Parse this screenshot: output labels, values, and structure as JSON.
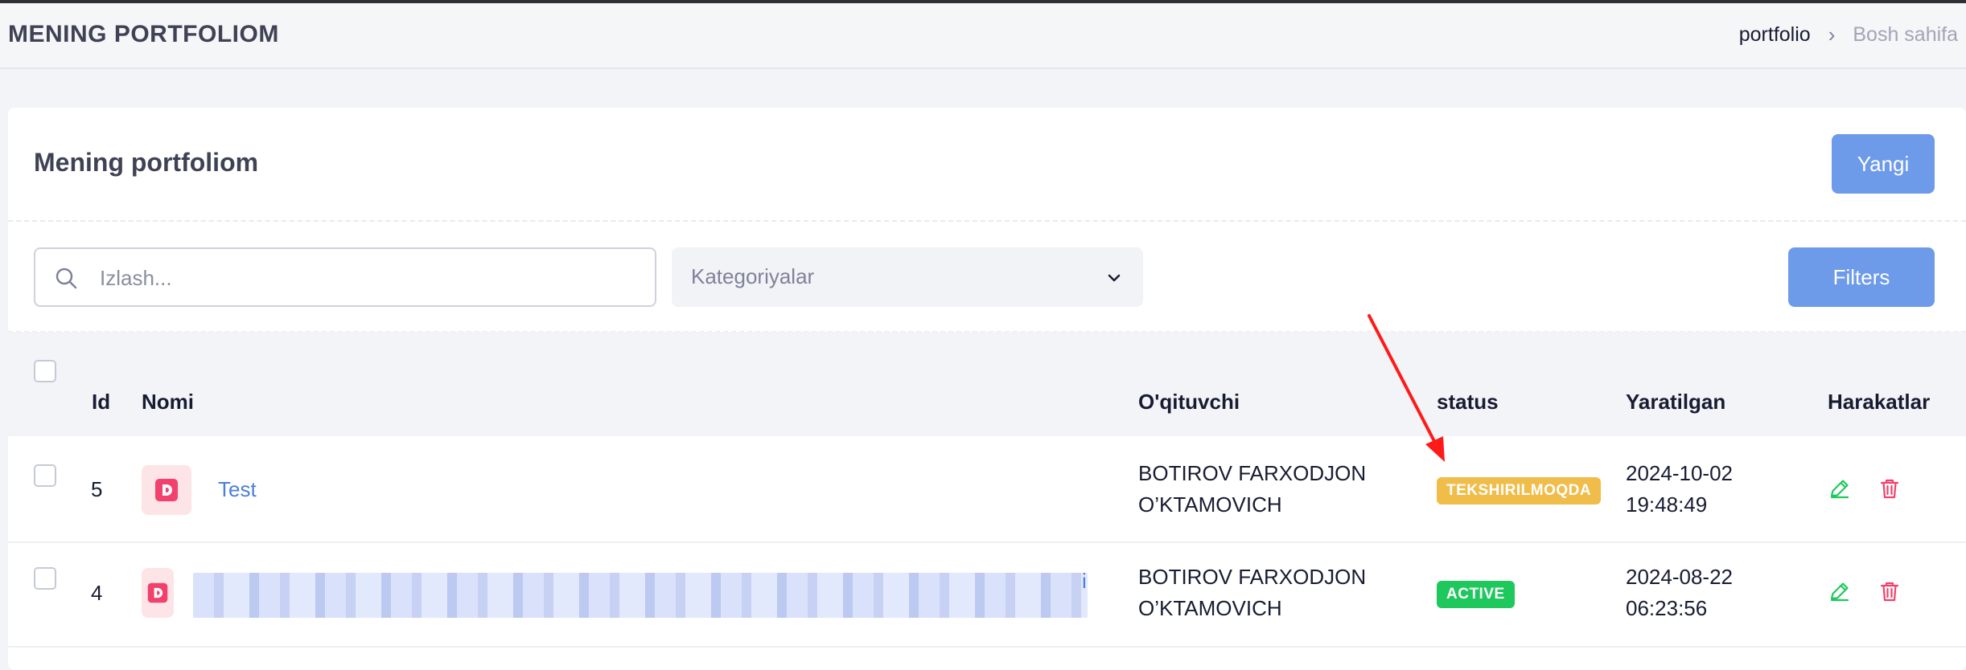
{
  "header": {
    "title": "MENING PORTFOLIOM",
    "breadcrumb": {
      "current": "portfolio",
      "separator": "›",
      "home": "Bosh sahifa"
    }
  },
  "card": {
    "title": "Mening portfoliom",
    "new_button": "Yangi",
    "filters_button": "Filters",
    "search_placeholder": "Izlash...",
    "category_select": "Kategoriyalar"
  },
  "table": {
    "columns": {
      "id": "Id",
      "name": "Nomi",
      "teacher": "O'qituvchi",
      "status": "status",
      "created": "Yaratilgan",
      "actions": "Harakatlar"
    },
    "rows": [
      {
        "id": "5",
        "name": "Test",
        "teacher_line1": "BOTIROV FARXODJON",
        "teacher_line2": "O’KTAMOVICH",
        "status": "TEKSHIRILMOQDA",
        "date": "2024-10-02",
        "time": "19:48:49"
      },
      {
        "id": "4",
        "name": "i",
        "teacher_line1": "BOTIROV FARXODJON",
        "teacher_line2": "O’KTAMOVICH",
        "status": "ACTIVE",
        "date": "2024-08-22",
        "time": "06:23:56"
      }
    ]
  },
  "icons": {
    "search": "search-icon",
    "chevron": "chevron-down-icon",
    "file": "pdf-file-icon",
    "edit": "edit-pencil-icon",
    "delete": "trash-icon"
  },
  "colors": {
    "primary_button": "#6d9ae9",
    "status_pending": "#f0bd4a",
    "status_active": "#1ec85c",
    "edit_icon": "#1ec85c",
    "delete_icon": "#f1416c",
    "annotation_arrow": "#ff1a1a"
  }
}
